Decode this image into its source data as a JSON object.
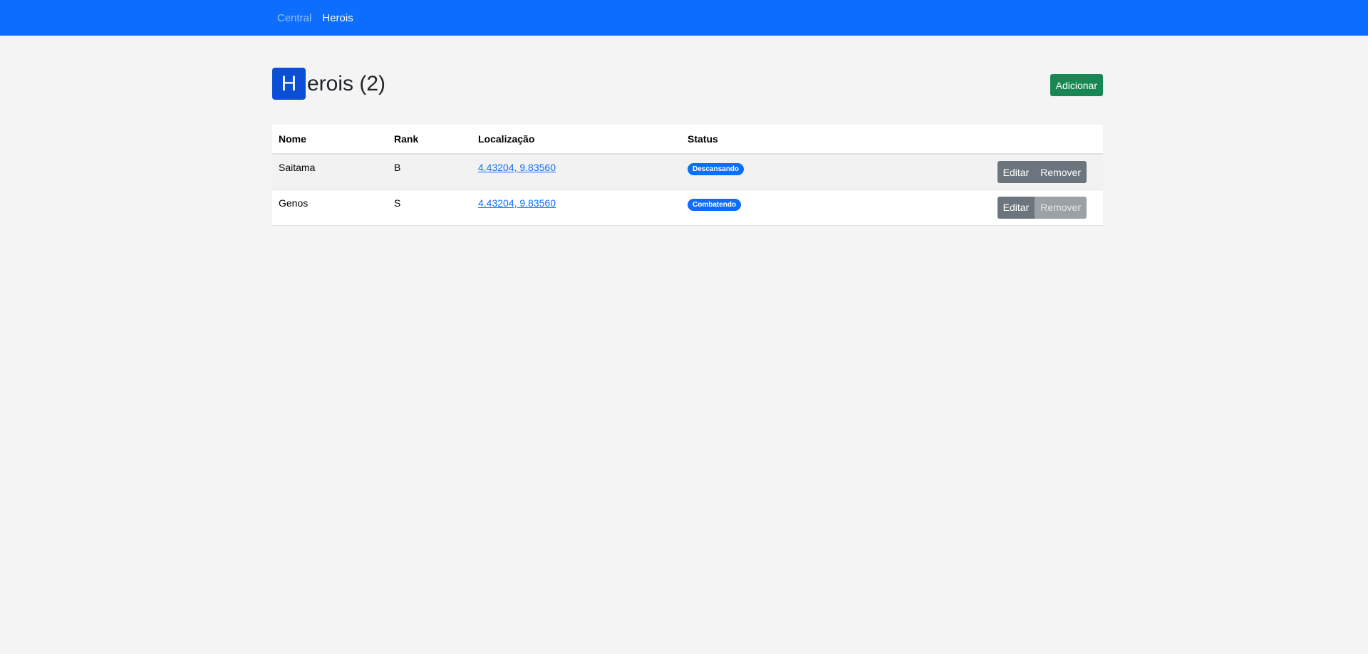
{
  "navbar": {
    "links": [
      {
        "label": "Central",
        "active": false
      },
      {
        "label": "Herois",
        "active": true
      }
    ]
  },
  "page": {
    "title_initial": "H",
    "title_rest": "erois (2)",
    "add_button": "Adicionar"
  },
  "table": {
    "headers": [
      "Nome",
      "Rank",
      "Localização",
      "Status",
      ""
    ],
    "rows": [
      {
        "name": "Saitama",
        "rank": "B",
        "location": "4.43204, 9.83560",
        "status": "Descansando",
        "edit": "Editar",
        "remove": "Remover",
        "remove_disabled": false
      },
      {
        "name": "Genos",
        "rank": "S",
        "location": "4.43204, 9.83560",
        "status": "Combatendo",
        "edit": "Editar",
        "remove": "Remover",
        "remove_disabled": true
      }
    ]
  },
  "colors": {
    "navbar": "#0d6efd",
    "title_badge": "#0b4fd6",
    "add_button": "#198754",
    "status_badge": "#0d6efd",
    "secondary_button": "#6c757d"
  }
}
